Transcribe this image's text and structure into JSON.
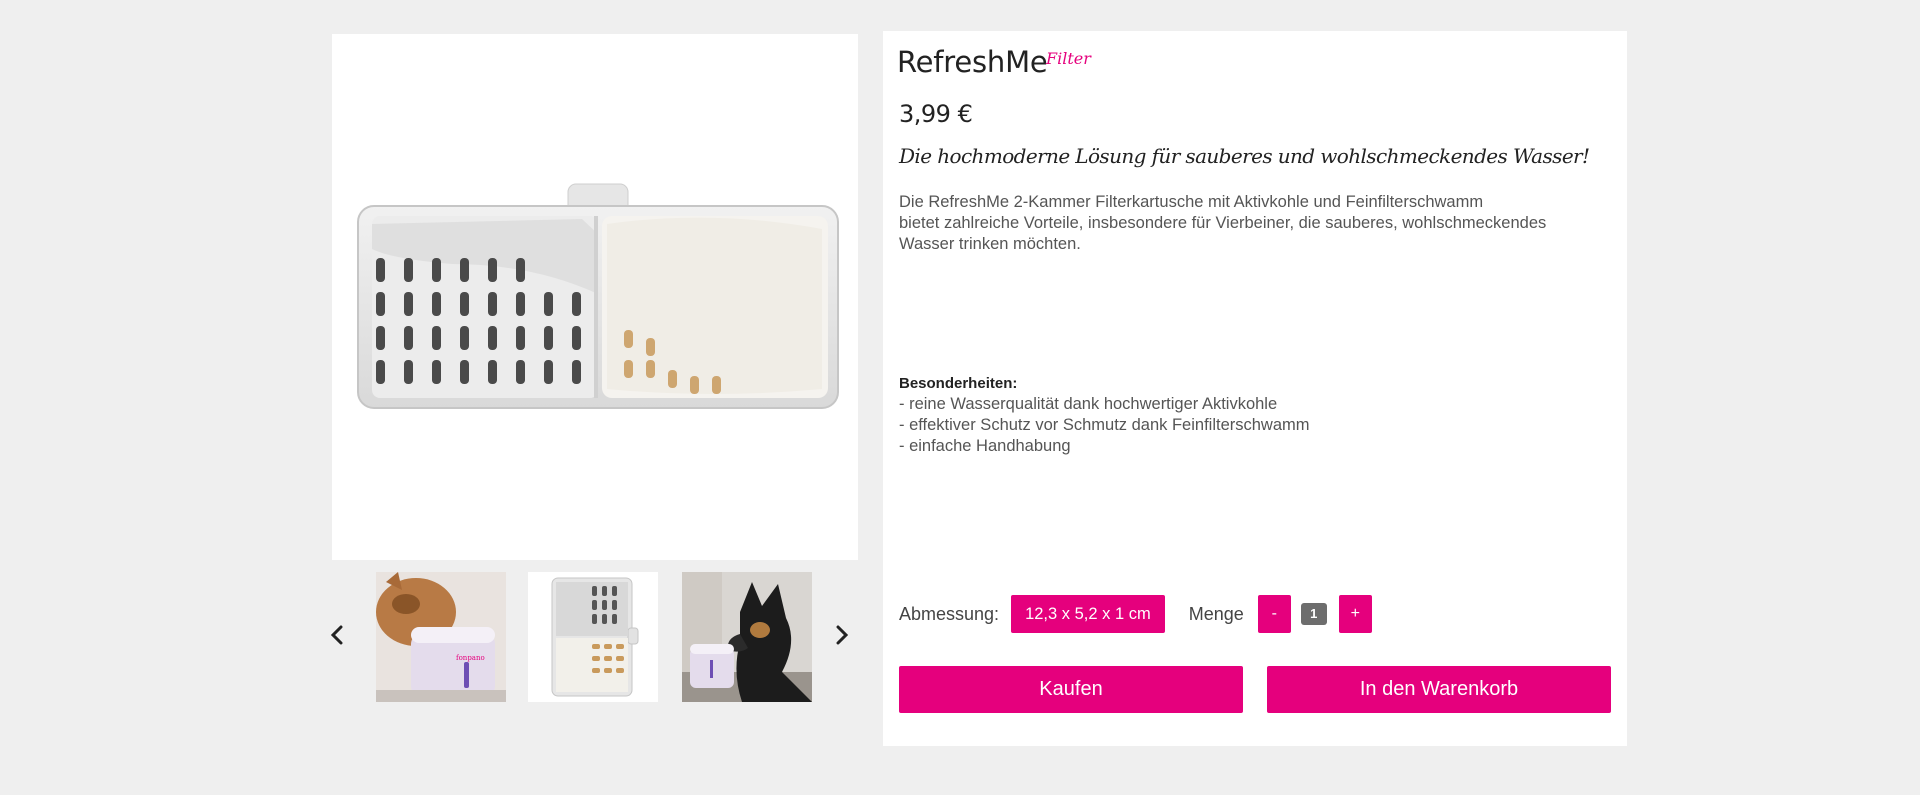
{
  "product": {
    "title": "RefreshMe",
    "title_tag": "Filter",
    "price": "3,99 €",
    "slogan": "Die hochmoderne Lösung für sauberes und wohlschmeckendes Wasser!",
    "description_lines": [
      "Die RefreshMe 2-Kammer Filterkartusche mit Aktivkohle und Feinfilterschwamm",
      "bietet zahlreiche Vorteile, insbesondere für Vierbeiner, die sauberes, wohlschmeckendes",
      "Wasser trinken möchten."
    ]
  },
  "features": {
    "heading": "Besonderheiten:",
    "items": [
      "- reine Wasserqualität dank hochwertiger Aktivkohle",
      "- effektiver Schutz vor Schmutz dank Feinfilterschwamm",
      "- einfache Handhabung"
    ]
  },
  "options": {
    "dimension_label": "Abmessung:",
    "dimension_value": "12,3 x 5,2 x 1 cm",
    "quantity_label": "Menge",
    "minus_label": "-",
    "quantity_value": "1",
    "plus_label": "+"
  },
  "actions": {
    "buy_label": "Kaufen",
    "cart_label": "In den Warenkorb"
  },
  "gallery": {
    "thumbnails": [
      "cat-drinking-fountain",
      "filter-cartridge",
      "dog-with-fountain"
    ]
  },
  "colors": {
    "accent": "#e5007d",
    "background": "#efefef",
    "panel": "#ffffff"
  }
}
